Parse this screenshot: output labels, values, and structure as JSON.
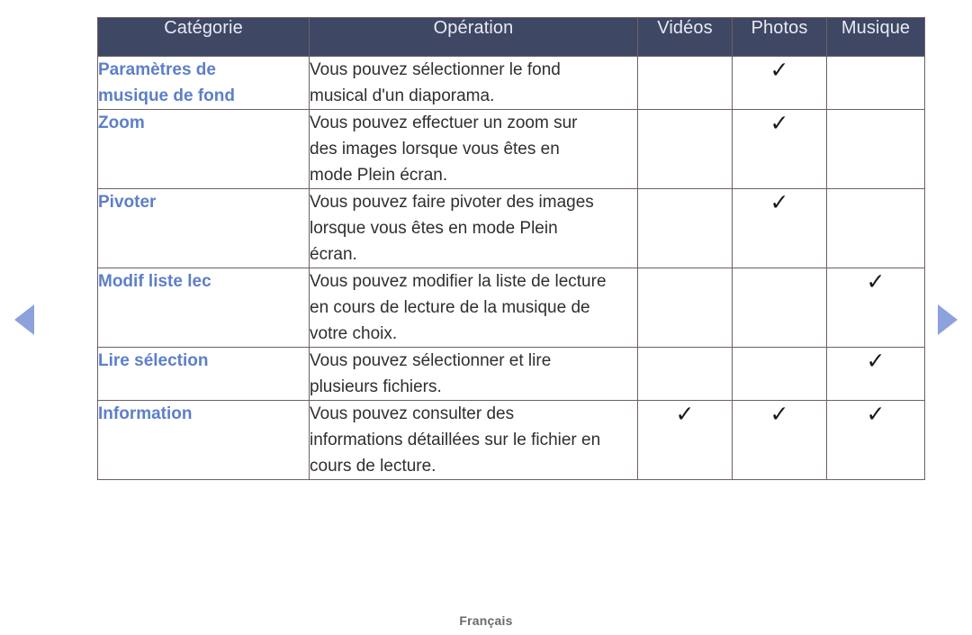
{
  "table": {
    "columns": [
      {
        "key": "category",
        "label": "Catégorie"
      },
      {
        "key": "operation",
        "label": "Opération"
      },
      {
        "key": "videos",
        "label": "Vidéos"
      },
      {
        "key": "photos",
        "label": "Photos"
      },
      {
        "key": "musique",
        "label": "Musique"
      }
    ],
    "rows": [
      {
        "category": "Paramètres de\nmusique de fond",
        "operation": "Vous pouvez sélectionner le fond\nmusical d'un diaporama.",
        "videos": "",
        "photos": "✓",
        "musique": ""
      },
      {
        "category": "Zoom",
        "operation": "Vous pouvez effectuer un zoom sur\ndes images lorsque vous êtes en\nmode Plein écran.",
        "videos": "",
        "photos": "✓",
        "musique": ""
      },
      {
        "category": "Pivoter",
        "operation": "Vous pouvez faire pivoter des images\nlorsque vous êtes en mode Plein\nécran.",
        "videos": "",
        "photos": "✓",
        "musique": ""
      },
      {
        "category": "Modif liste lec",
        "operation": "Vous pouvez modifier la liste de lecture\nen cours de lecture de la musique de\nvotre choix.",
        "videos": "",
        "photos": "",
        "musique": "✓"
      },
      {
        "category": "Lire sélection",
        "operation": "Vous pouvez sélectionner et lire\nplusieurs fichiers.",
        "videos": "",
        "photos": "",
        "musique": "✓"
      },
      {
        "category": "Information",
        "operation": "Vous pouvez consulter des\ninformations détaillées sur le fichier en\ncours de lecture.",
        "videos": "✓",
        "photos": "✓",
        "musique": "✓"
      }
    ]
  },
  "navigation": {
    "previous_icon": "triangle-left-icon",
    "next_icon": "triangle-right-icon"
  },
  "footer": {
    "language": "Français"
  },
  "colors": {
    "header_background": "#3e4764",
    "header_text": "#e9eaf0",
    "category_text": "#5d7fc9",
    "body_text": "#2f2f2f",
    "border": "#6d6063",
    "arrow": "#8da2dd",
    "footer_text": "#6a6a6a"
  }
}
